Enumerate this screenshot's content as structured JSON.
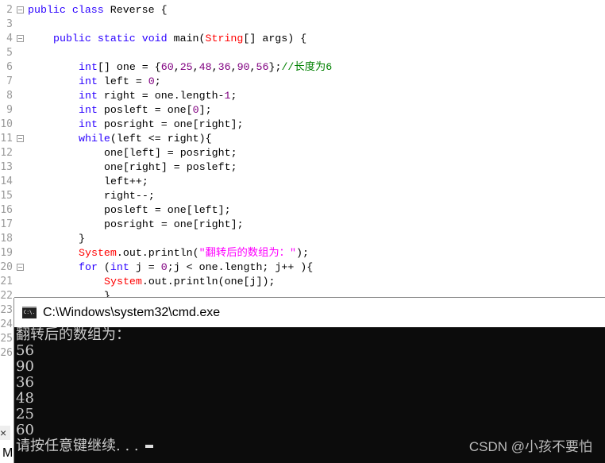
{
  "editor": {
    "lines": [
      {
        "n": "2",
        "fold": true,
        "indent": 0,
        "tokens": [
          [
            "kw",
            "public class "
          ],
          [
            "plain",
            "Reverse {"
          ]
        ]
      },
      {
        "n": "3",
        "fold": false,
        "indent": 0,
        "tokens": []
      },
      {
        "n": "4",
        "fold": true,
        "indent": 4,
        "tokens": [
          [
            "kw",
            "public static void "
          ],
          [
            "plain",
            "main("
          ],
          [
            "cls",
            "String"
          ],
          [
            "plain",
            "[] args) {"
          ]
        ]
      },
      {
        "n": "5",
        "fold": false,
        "indent": 0,
        "tokens": []
      },
      {
        "n": "6",
        "fold": false,
        "indent": 8,
        "tokens": [
          [
            "kw",
            "int"
          ],
          [
            "plain",
            "[] one = {"
          ],
          [
            "num",
            "60"
          ],
          [
            "plain",
            ","
          ],
          [
            "num",
            "25"
          ],
          [
            "plain",
            ","
          ],
          [
            "num",
            "48"
          ],
          [
            "plain",
            ","
          ],
          [
            "num",
            "36"
          ],
          [
            "plain",
            ","
          ],
          [
            "num",
            "90"
          ],
          [
            "plain",
            ","
          ],
          [
            "num",
            "56"
          ],
          [
            "plain",
            "};"
          ],
          [
            "cmt",
            "//长度为6"
          ]
        ]
      },
      {
        "n": "7",
        "fold": false,
        "indent": 8,
        "tokens": [
          [
            "kw",
            "int "
          ],
          [
            "plain",
            "left = "
          ],
          [
            "num",
            "0"
          ],
          [
            "plain",
            ";"
          ]
        ]
      },
      {
        "n": "8",
        "fold": false,
        "indent": 8,
        "tokens": [
          [
            "kw",
            "int "
          ],
          [
            "plain",
            "right = one.length-"
          ],
          [
            "num",
            "1"
          ],
          [
            "plain",
            ";"
          ]
        ]
      },
      {
        "n": "9",
        "fold": false,
        "indent": 8,
        "tokens": [
          [
            "kw",
            "int "
          ],
          [
            "plain",
            "posleft = one["
          ],
          [
            "num",
            "0"
          ],
          [
            "plain",
            "];"
          ]
        ]
      },
      {
        "n": "10",
        "fold": false,
        "indent": 8,
        "tokens": [
          [
            "kw",
            "int "
          ],
          [
            "plain",
            "posright = one[right];"
          ]
        ]
      },
      {
        "n": "11",
        "fold": true,
        "indent": 8,
        "tokens": [
          [
            "kw",
            "while"
          ],
          [
            "plain",
            "(left <= right){"
          ]
        ]
      },
      {
        "n": "12",
        "fold": false,
        "indent": 12,
        "tokens": [
          [
            "plain",
            "one[left] = posright;"
          ]
        ]
      },
      {
        "n": "13",
        "fold": false,
        "indent": 12,
        "tokens": [
          [
            "plain",
            "one[right] = posleft;"
          ]
        ]
      },
      {
        "n": "14",
        "fold": false,
        "indent": 12,
        "tokens": [
          [
            "plain",
            "left++;"
          ]
        ]
      },
      {
        "n": "15",
        "fold": false,
        "indent": 12,
        "tokens": [
          [
            "plain",
            "right--;"
          ]
        ]
      },
      {
        "n": "16",
        "fold": false,
        "indent": 12,
        "tokens": [
          [
            "plain",
            "posleft = one[left];"
          ]
        ]
      },
      {
        "n": "17",
        "fold": false,
        "indent": 12,
        "tokens": [
          [
            "plain",
            "posright = one[right];"
          ]
        ]
      },
      {
        "n": "18",
        "fold": false,
        "indent": 8,
        "tokens": [
          [
            "plain",
            "}"
          ]
        ]
      },
      {
        "n": "19",
        "fold": false,
        "indent": 8,
        "tokens": [
          [
            "cls",
            "System"
          ],
          [
            "plain",
            ".out.println("
          ],
          [
            "str",
            "\"翻转后的数组为：\""
          ],
          [
            "plain",
            ");"
          ]
        ]
      },
      {
        "n": "20",
        "fold": true,
        "indent": 8,
        "tokens": [
          [
            "kw",
            "for "
          ],
          [
            "plain",
            "("
          ],
          [
            "kw",
            "int "
          ],
          [
            "plain",
            "j = "
          ],
          [
            "num",
            "0"
          ],
          [
            "plain",
            ";j < one.length; j++ ){"
          ]
        ]
      },
      {
        "n": "21",
        "fold": false,
        "indent": 12,
        "tokens": [
          [
            "cls",
            "System"
          ],
          [
            "plain",
            ".out.println(one[j]);"
          ]
        ]
      },
      {
        "n": "22",
        "fold": false,
        "indent": 12,
        "tokens": [
          [
            "plain",
            "}"
          ]
        ]
      },
      {
        "n": "23",
        "fold": false,
        "indent": 0,
        "tokens": []
      },
      {
        "n": "24",
        "fold": false,
        "indent": 0,
        "tokens": []
      },
      {
        "n": "25",
        "fold": false,
        "indent": 0,
        "tokens": []
      },
      {
        "n": "26",
        "fold": false,
        "indent": 0,
        "tokens": []
      }
    ],
    "side_close": "×",
    "side_label": "M"
  },
  "cmd": {
    "title": "C:\\Windows\\system32\\cmd.exe",
    "icon": "cmd-icon",
    "icon_text": "C:\\.",
    "output": [
      "翻转后的数组为：",
      "56",
      "90",
      "36",
      "48",
      "25",
      "60"
    ],
    "prompt": "请按任意键继续. . ."
  },
  "watermark": "CSDN @小孩不要怕",
  "colors": {
    "keyword": "#2a00ff",
    "class": "#ff0000",
    "number": "#800080",
    "string": "#ff00ff",
    "comment": "#008000",
    "console_bg": "#0c0c0c"
  }
}
